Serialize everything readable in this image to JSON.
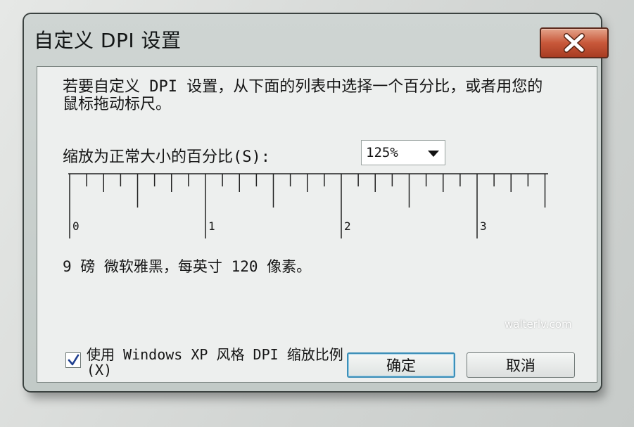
{
  "window": {
    "title": "自定义 DPI 设置",
    "close_icon": "close-icon"
  },
  "content": {
    "description": "若要自定义 DPI 设置，从下面的列表中选择一个百分比，或者用您的鼠标拖动标尺。",
    "scale_label": "缩放为正常大小的百分比(S):",
    "scale_select": {
      "selected": "125%"
    },
    "ruler": {
      "labels": [
        "0",
        "1",
        "2",
        "3"
      ]
    },
    "info": "9 磅 微软雅黑，每英寸 120 像素。"
  },
  "footer": {
    "xp_scaling_checkbox": {
      "checked": true,
      "label": "使用 Windows XP 风格 DPI 缩放比例(X)"
    },
    "ok_label": "确定",
    "cancel_label": "取消"
  },
  "watermark": "walterlv.com",
  "colors": {
    "close_button": "#c8583a",
    "ok_button_border": "#3c8fb8",
    "client_background": "#edefee"
  }
}
